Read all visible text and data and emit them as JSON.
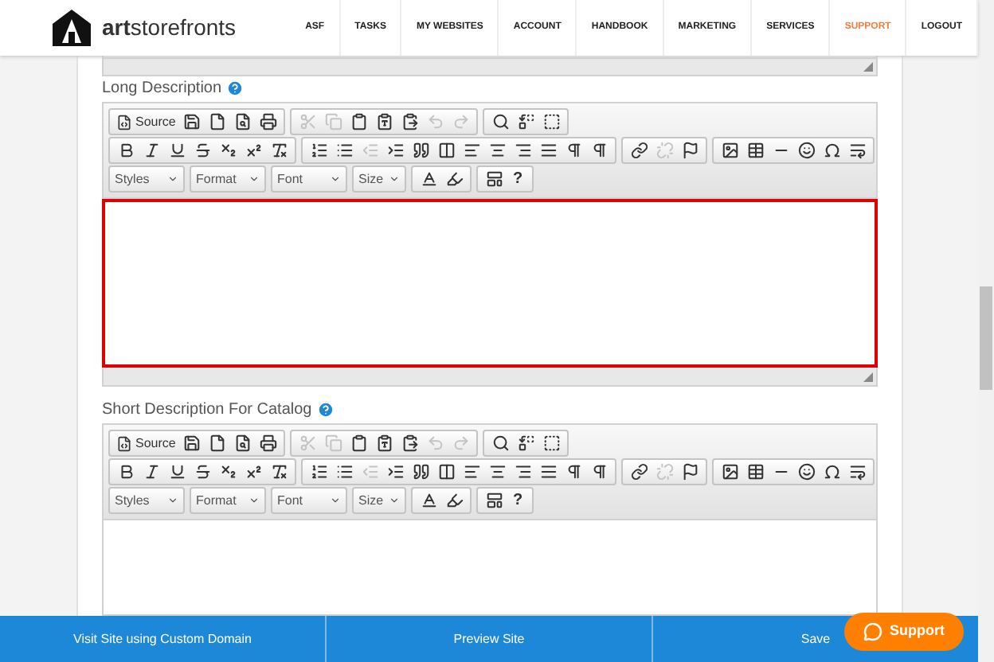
{
  "logo": {
    "text": "**art**storefronts"
  },
  "nav": [
    {
      "label": "ASF",
      "selected": false
    },
    {
      "label": "TASKS",
      "selected": false
    },
    {
      "label": "MY WEBSITES",
      "selected": false
    },
    {
      "label": "ACCOUNT",
      "selected": false
    },
    {
      "label": "HANDBOOK",
      "selected": false
    },
    {
      "label": "MARKETING",
      "selected": false
    },
    {
      "label": "SERVICES",
      "selected": false
    },
    {
      "label": "SUPPORT",
      "selected": true
    },
    {
      "label": "LOGOUT",
      "selected": false
    }
  ],
  "editors": [
    {
      "label": "Long Description",
      "source_label": "Source",
      "combos": [
        "Styles",
        "Format",
        "Font",
        "Size"
      ],
      "help": "?",
      "clipboard_disabled": true,
      "undo_disabled": true,
      "outdent_disabled": true,
      "unlink_disabled": true,
      "invalid": true,
      "cut_off": false
    },
    {
      "label": "Short Description For Catalog",
      "source_label": "Source",
      "combos": [
        "Styles",
        "Format",
        "Font",
        "Size"
      ],
      "help": "?",
      "clipboard_disabled": true,
      "undo_disabled": true,
      "outdent_disabled": true,
      "unlink_disabled": true,
      "invalid": false,
      "cut_off": true
    }
  ],
  "footer": [
    "Visit Site using Custom Domain",
    "Preview Site",
    "Save"
  ],
  "support_button": "Support"
}
